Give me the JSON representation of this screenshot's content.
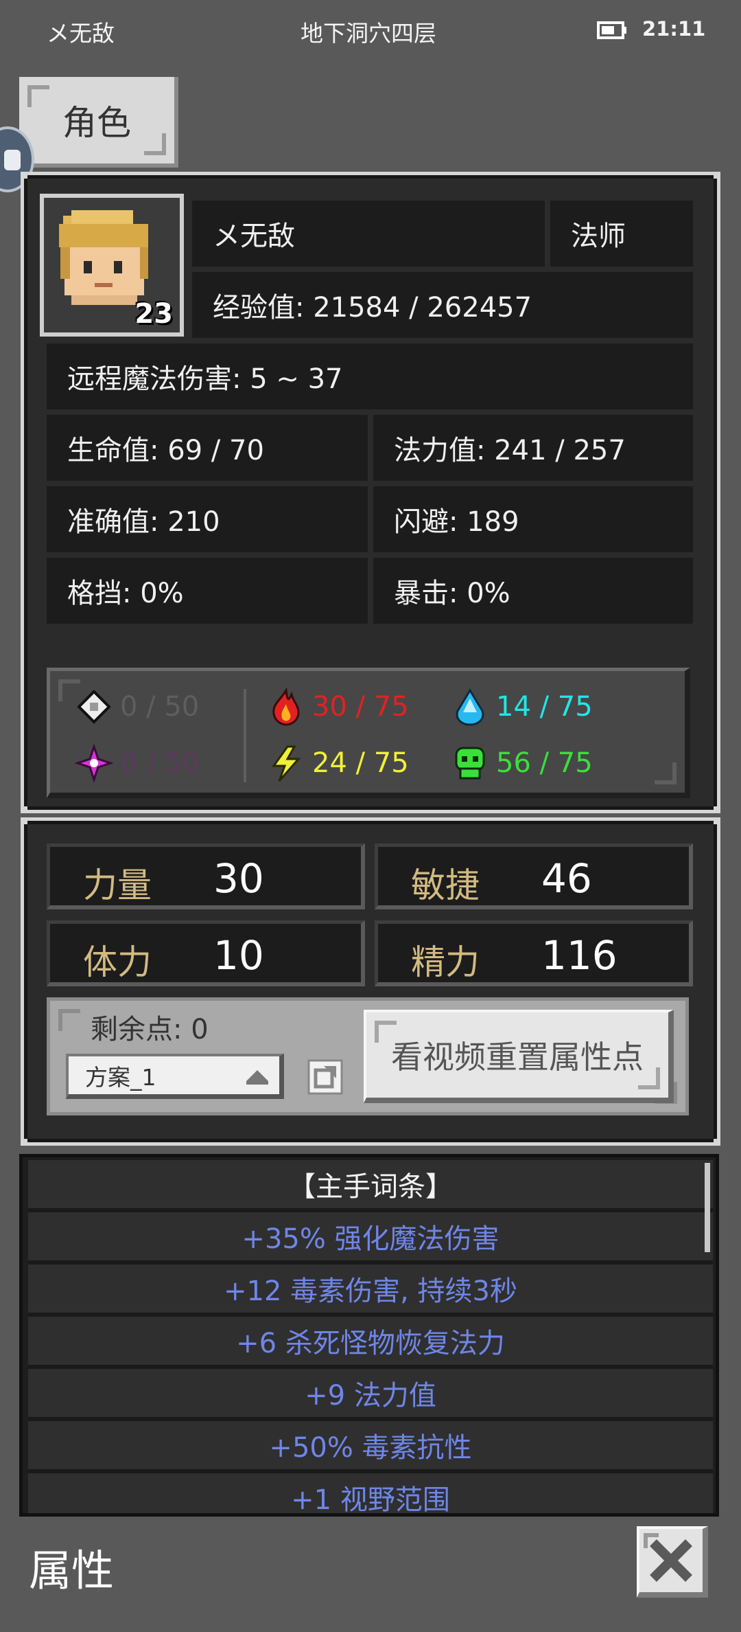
{
  "status_bar": {
    "player": "メ无敌",
    "location": "地下洞穴四层",
    "time": "21:11",
    "battery_level": 0.6
  },
  "tab": {
    "label": "角色"
  },
  "character": {
    "name": "メ无敌",
    "class": "法师",
    "level": "23",
    "experience": "经验值: 21584 / 262457",
    "damage": "远程魔法伤害: 5 ~ 37",
    "stats": {
      "hp": "生命值: 69 / 70",
      "mp": "法力值: 241 / 257",
      "accuracy": "准确值: 210",
      "dodge": "闪避: 189",
      "block": "格挡: 0%",
      "crit": "暴击: 0%"
    }
  },
  "elements": {
    "physical": {
      "value": "0 / 50",
      "color": "#5e5e5e"
    },
    "arcane": {
      "value": "0 / 50",
      "color": "#5c3a5c"
    },
    "fire": {
      "value": "30 / 75",
      "color": "#e02222"
    },
    "lightning": {
      "value": "24 / 75",
      "color": "#f0f03a"
    },
    "ice": {
      "value": "14 / 75",
      "color": "#22e6e6"
    },
    "poison": {
      "value": "56 / 75",
      "color": "#3ae03a"
    }
  },
  "attributes": {
    "strength": {
      "label": "力量",
      "value": "30"
    },
    "agility": {
      "label": "敏捷",
      "value": "46"
    },
    "stamina": {
      "label": "体力",
      "value": "10"
    },
    "spirit": {
      "label": "精力",
      "value": "116"
    }
  },
  "points": {
    "remaining": "剩余点: 0",
    "plan": "方案_1",
    "reset_button": "看视频重置属性点"
  },
  "affixes": {
    "title": "【主手词条】",
    "items": [
      "+35% 强化魔法伤害",
      "+12 毒素伤害, 持续3秒",
      "+6 杀死怪物恢复法力",
      "+9 法力值",
      "+50% 毒素抗性",
      "+1 视野范围"
    ]
  },
  "footer": {
    "title": "属性"
  },
  "icons": [
    "battery-icon",
    "hero-portrait",
    "physical-shard-icon",
    "fire-icon",
    "ice-drop-icon",
    "arcane-star-icon",
    "lightning-icon",
    "poison-skull-icon",
    "share-icon",
    "close-icon"
  ]
}
